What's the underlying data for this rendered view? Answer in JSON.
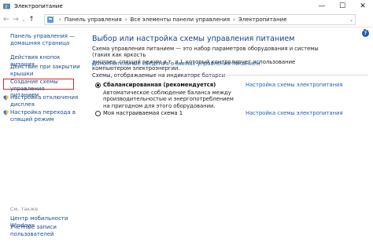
{
  "window": {
    "title": "Электропитание",
    "controls": {
      "minimize": "—",
      "maximize": "☐",
      "close": "✕"
    }
  },
  "address_bar": {
    "back": "←",
    "forward": "→",
    "recent": "⌄",
    "up": "↑",
    "crumbs": [
      "Панель управления",
      "Все элементы панели управления",
      "Электропитание"
    ],
    "separator": "›",
    "dropdown": "⌄",
    "refresh": "↻"
  },
  "sidebar": {
    "home_link_line1": "Панель управления —",
    "home_link_line2": "домашняя страница",
    "items": [
      {
        "label": "Действия кнопок питания"
      },
      {
        "label_line1": "Действие при закрытии",
        "label_line2": "крышки"
      },
      {
        "label_line1": "Создание схемы управления",
        "label_line2": "питанием"
      },
      {
        "label_line1": "Настройка отключения",
        "label_line2": "дисплея"
      },
      {
        "label_line1": "Настройка перехода в",
        "label_line2": "спящий режим"
      }
    ],
    "see_also": {
      "heading": "См. также",
      "link1": "Центр мобильности Windows",
      "link2_line1": "Учетные записи",
      "link2_line2": "пользователей"
    }
  },
  "main": {
    "title": "Выбор или настройка схемы управления питанием",
    "description_line1": "Схема управления питанием — это набор параметров оборудования и системы (таких как яркость",
    "description_line2": "дисплея, спящий режим и т. д.), который контролирует использование компьютером электроэнергии.",
    "more_link": "Дополнительные сведения о схемах управления питанием",
    "group_label": "Схемы, отображаемые на индикаторе батареи",
    "plans": [
      {
        "name": "Сбалансированная (рекомендуется)",
        "selected": true,
        "desc_line1": "Автоматическое соблюдение баланса между производительностью и энергопотреблением",
        "desc_line2": "на пригодном для этого оборудовании.",
        "settings_link": "Настройка схемы электропитания"
      },
      {
        "name": "Моя настраиваемая схема 1",
        "selected": false,
        "settings_link": "Настройка схемы электропитания"
      }
    ],
    "help": "?"
  },
  "colors": {
    "link": "#1a5fb4",
    "title": "#1a3f8a",
    "highlight_border": "#d8242c"
  }
}
